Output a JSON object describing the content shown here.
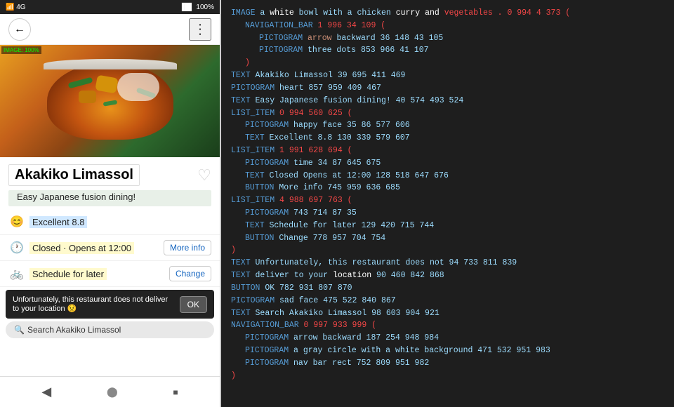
{
  "mobile": {
    "status_bar": "4G",
    "restaurant_name": "Akakiko Limassol",
    "heart_label": "♡",
    "tagline": "Easy Japanese fusion dining!",
    "rating_icon": "😊",
    "rating_text": "Excellent 8.8",
    "time_icon": "🕐",
    "closed_text": "Closed · Opens at 12:00",
    "more_info_btn": "More info",
    "delivery_icon": "🚲",
    "delivery_text": "Schedule for later",
    "change_btn": "Change",
    "warning_text": "Unfortunately, this restaurant does not deliver to your location 😟",
    "ok_btn": "OK",
    "search_text": "Search Akakiko Limassol",
    "back_icon": "←",
    "dots_icon": "⋮",
    "nav_back": "◀",
    "nav_circle": "⬤",
    "nav_square": "■"
  },
  "code": {
    "lines": [
      {
        "indent": 0,
        "parts": [
          {
            "text": "IMAGE",
            "cls": "c-blue"
          },
          {
            "text": " a ",
            "cls": "c-cyan"
          },
          {
            "text": "white",
            "cls": "c-white"
          },
          {
            "text": " bowl with a chicken ",
            "cls": "c-cyan"
          },
          {
            "text": "curry",
            "cls": "c-white"
          },
          {
            "text": " ",
            "cls": "c-cyan"
          },
          {
            "text": "and",
            "cls": "c-white"
          },
          {
            "text": " vegetables . 0 994 4 373 (",
            "cls": "c-red"
          }
        ]
      },
      {
        "indent": 1,
        "parts": [
          {
            "text": "NAVIGATION_BAR",
            "cls": "c-blue"
          },
          {
            "text": " 1 996 34 109 (",
            "cls": "c-red"
          }
        ]
      },
      {
        "indent": 2,
        "parts": [
          {
            "text": "PICTOGRAM",
            "cls": "c-blue"
          },
          {
            "text": " ",
            "cls": "c-white"
          },
          {
            "text": "arrow",
            "cls": "c-orange"
          },
          {
            "text": " backward 36 148 43 105",
            "cls": "c-cyan"
          }
        ]
      },
      {
        "indent": 2,
        "parts": [
          {
            "text": "PICTOGRAM",
            "cls": "c-blue"
          },
          {
            "text": " three dots 853 966 41 107",
            "cls": "c-cyan"
          }
        ]
      },
      {
        "indent": 1,
        "parts": [
          {
            "text": ")",
            "cls": "c-red"
          }
        ]
      },
      {
        "indent": 0,
        "parts": [
          {
            "text": "TEXT",
            "cls": "c-blue"
          },
          {
            "text": " Akakiko Limassol 39 695 411 469",
            "cls": "c-cyan"
          }
        ]
      },
      {
        "indent": 0,
        "parts": [
          {
            "text": "PICTOGRAM",
            "cls": "c-blue"
          },
          {
            "text": " heart 857 959 409 467",
            "cls": "c-cyan"
          }
        ]
      },
      {
        "indent": 0,
        "parts": [
          {
            "text": "TEXT",
            "cls": "c-blue"
          },
          {
            "text": " Easy Japanese fusion dining! 40 574 493 524",
            "cls": "c-cyan"
          }
        ]
      },
      {
        "indent": 0,
        "parts": [
          {
            "text": "LIST_ITEM",
            "cls": "c-blue"
          },
          {
            "text": " 0 994 560 625 (",
            "cls": "c-red"
          }
        ]
      },
      {
        "indent": 1,
        "parts": [
          {
            "text": "PICTOGRAM",
            "cls": "c-blue"
          },
          {
            "text": " happy face 35 86 577 606",
            "cls": "c-cyan"
          }
        ]
      },
      {
        "indent": 1,
        "parts": [
          {
            "text": "TEXT",
            "cls": "c-blue"
          },
          {
            "text": " Excellent 8.8 130 339 579 607",
            "cls": "c-cyan"
          }
        ]
      },
      {
        "indent": 0,
        "parts": [
          {
            "text": "LIST_ITEM",
            "cls": "c-blue"
          },
          {
            "text": " 1 991 628 694 (",
            "cls": "c-red"
          }
        ]
      },
      {
        "indent": 1,
        "parts": [
          {
            "text": "PICTOGRAM",
            "cls": "c-blue"
          },
          {
            "text": " time 34 87 645 675",
            "cls": "c-cyan"
          }
        ]
      },
      {
        "indent": 1,
        "parts": [
          {
            "text": "TEXT",
            "cls": "c-blue"
          },
          {
            "text": " Closed Opens at 12:00 128 518 647 676",
            "cls": "c-cyan"
          }
        ]
      },
      {
        "indent": 1,
        "parts": [
          {
            "text": "BUTTON",
            "cls": "c-blue"
          },
          {
            "text": " More info 745 959 636 685",
            "cls": "c-cyan"
          }
        ]
      },
      {
        "indent": 0,
        "parts": [
          {
            "text": "LIST_ITEM",
            "cls": "c-blue"
          },
          {
            "text": " 4 988 697 763 (",
            "cls": "c-red"
          }
        ]
      },
      {
        "indent": 1,
        "parts": [
          {
            "text": "PICTOGRAM",
            "cls": "c-blue"
          },
          {
            "text": " 743 714 87 35",
            "cls": "c-cyan"
          }
        ]
      },
      {
        "indent": 1,
        "parts": [
          {
            "text": "TEXT",
            "cls": "c-blue"
          },
          {
            "text": " Schedule for later 129 420 715 744",
            "cls": "c-cyan"
          }
        ]
      },
      {
        "indent": 1,
        "parts": [
          {
            "text": "BUTTON",
            "cls": "c-blue"
          },
          {
            "text": " Change 778 957 704 754",
            "cls": "c-cyan"
          }
        ]
      },
      {
        "indent": 0,
        "parts": [
          {
            "text": ")",
            "cls": "c-red"
          }
        ]
      },
      {
        "indent": 0,
        "parts": [
          {
            "text": "TEXT",
            "cls": "c-blue"
          },
          {
            "text": " Unfortunately, this restaurant does not 94 733 811 839",
            "cls": "c-cyan"
          }
        ]
      },
      {
        "indent": 0,
        "parts": [
          {
            "text": "TEXT",
            "cls": "c-blue"
          },
          {
            "text": " deliver to your ",
            "cls": "c-cyan"
          },
          {
            "text": "location",
            "cls": "c-white"
          },
          {
            "text": " 90 460 842 868",
            "cls": "c-cyan"
          }
        ]
      },
      {
        "indent": 0,
        "parts": [
          {
            "text": "BUTTON",
            "cls": "c-blue"
          },
          {
            "text": " OK 782 931 807 870",
            "cls": "c-cyan"
          }
        ]
      },
      {
        "indent": 0,
        "parts": [
          {
            "text": "PICTOGRAM",
            "cls": "c-blue"
          },
          {
            "text": " sad face 475 522 840 867",
            "cls": "c-cyan"
          }
        ]
      },
      {
        "indent": 0,
        "parts": [
          {
            "text": "TEXT",
            "cls": "c-blue"
          },
          {
            "text": " Search Akakiko Limassol 98 603 904 921",
            "cls": "c-cyan"
          }
        ]
      },
      {
        "indent": 0,
        "parts": [
          {
            "text": "NAVIGATION_BAR",
            "cls": "c-blue"
          },
          {
            "text": " 0 997 933 999 (",
            "cls": "c-red"
          }
        ]
      },
      {
        "indent": 1,
        "parts": [
          {
            "text": "PICTOGRAM",
            "cls": "c-blue"
          },
          {
            "text": " arrow backward 187 254 948 984",
            "cls": "c-cyan"
          }
        ]
      },
      {
        "indent": 1,
        "parts": [
          {
            "text": "PICTOGRAM",
            "cls": "c-blue"
          },
          {
            "text": " a gray circle with a white background 471 532 951 983",
            "cls": "c-cyan"
          }
        ]
      },
      {
        "indent": 1,
        "parts": [
          {
            "text": "PICTOGRAM",
            "cls": "c-blue"
          },
          {
            "text": " nav bar rect 752 809 951 982",
            "cls": "c-cyan"
          }
        ]
      },
      {
        "indent": 0,
        "parts": [
          {
            "text": ")",
            "cls": "c-red"
          }
        ]
      }
    ]
  }
}
